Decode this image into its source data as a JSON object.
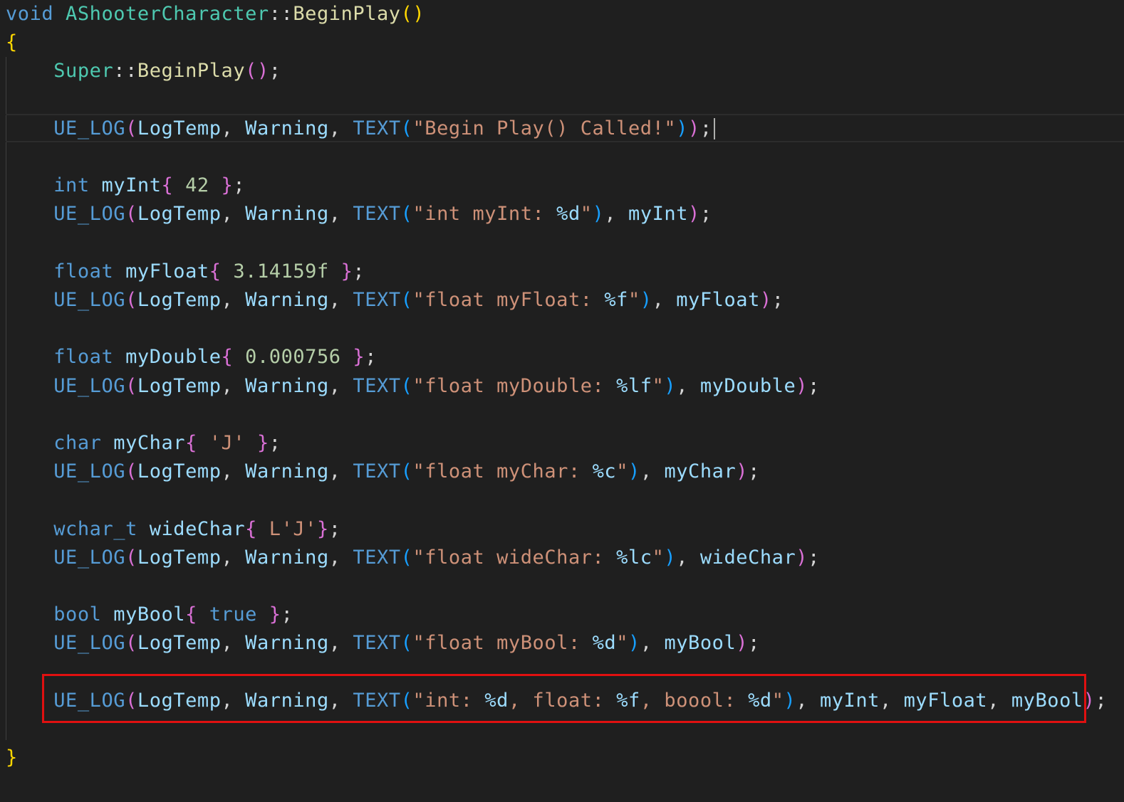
{
  "editor": {
    "cursor_line": 4,
    "highlighted_line": 27,
    "lines": [
      [
        {
          "t": "void ",
          "c": "kw"
        },
        {
          "t": "AShooterCharacter",
          "c": "type"
        },
        {
          "t": "::",
          "c": "plain"
        },
        {
          "t": "BeginPlay",
          "c": "fn"
        },
        {
          "t": "()",
          "c": "b1"
        }
      ],
      [
        {
          "t": "{",
          "c": "b1"
        }
      ],
      [
        {
          "t": "    ",
          "c": "plain"
        },
        {
          "t": "Super",
          "c": "type"
        },
        {
          "t": "::",
          "c": "plain"
        },
        {
          "t": "BeginPlay",
          "c": "fn"
        },
        {
          "t": "()",
          "c": "b2"
        },
        {
          "t": ";",
          "c": "plain"
        }
      ],
      [],
      [
        {
          "t": "    ",
          "c": "plain"
        },
        {
          "t": "UE_LOG",
          "c": "macro"
        },
        {
          "t": "(",
          "c": "b2"
        },
        {
          "t": "LogTemp",
          "c": "var"
        },
        {
          "t": ", ",
          "c": "plain"
        },
        {
          "t": "Warning",
          "c": "var"
        },
        {
          "t": ", ",
          "c": "plain"
        },
        {
          "t": "TEXT",
          "c": "macro"
        },
        {
          "t": "(",
          "c": "b3"
        },
        {
          "t": "\"Begin Play() Called!\"",
          "c": "str"
        },
        {
          "t": ")",
          "c": "b3"
        },
        {
          "t": ")",
          "c": "b2"
        },
        {
          "t": ";",
          "c": "plain"
        }
      ],
      [],
      [
        {
          "t": "    ",
          "c": "plain"
        },
        {
          "t": "int ",
          "c": "kw"
        },
        {
          "t": "myInt",
          "c": "var"
        },
        {
          "t": "{",
          "c": "b2"
        },
        {
          "t": " 42 ",
          "c": "num"
        },
        {
          "t": "}",
          "c": "b2"
        },
        {
          "t": ";",
          "c": "plain"
        }
      ],
      [
        {
          "t": "    ",
          "c": "plain"
        },
        {
          "t": "UE_LOG",
          "c": "macro"
        },
        {
          "t": "(",
          "c": "b2"
        },
        {
          "t": "LogTemp",
          "c": "var"
        },
        {
          "t": ", ",
          "c": "plain"
        },
        {
          "t": "Warning",
          "c": "var"
        },
        {
          "t": ", ",
          "c": "plain"
        },
        {
          "t": "TEXT",
          "c": "macro"
        },
        {
          "t": "(",
          "c": "b3"
        },
        {
          "t": "\"int myInt: ",
          "c": "str"
        },
        {
          "t": "%d",
          "c": "var"
        },
        {
          "t": "\"",
          "c": "str"
        },
        {
          "t": ")",
          "c": "b3"
        },
        {
          "t": ", ",
          "c": "plain"
        },
        {
          "t": "myInt",
          "c": "var"
        },
        {
          "t": ")",
          "c": "b2"
        },
        {
          "t": ";",
          "c": "plain"
        }
      ],
      [],
      [
        {
          "t": "    ",
          "c": "plain"
        },
        {
          "t": "float ",
          "c": "kw"
        },
        {
          "t": "myFloat",
          "c": "var"
        },
        {
          "t": "{",
          "c": "b2"
        },
        {
          "t": " 3.14159f ",
          "c": "num"
        },
        {
          "t": "}",
          "c": "b2"
        },
        {
          "t": ";",
          "c": "plain"
        }
      ],
      [
        {
          "t": "    ",
          "c": "plain"
        },
        {
          "t": "UE_LOG",
          "c": "macro"
        },
        {
          "t": "(",
          "c": "b2"
        },
        {
          "t": "LogTemp",
          "c": "var"
        },
        {
          "t": ", ",
          "c": "plain"
        },
        {
          "t": "Warning",
          "c": "var"
        },
        {
          "t": ", ",
          "c": "plain"
        },
        {
          "t": "TEXT",
          "c": "macro"
        },
        {
          "t": "(",
          "c": "b3"
        },
        {
          "t": "\"float myFloat: ",
          "c": "str"
        },
        {
          "t": "%f",
          "c": "var"
        },
        {
          "t": "\"",
          "c": "str"
        },
        {
          "t": ")",
          "c": "b3"
        },
        {
          "t": ", ",
          "c": "plain"
        },
        {
          "t": "myFloat",
          "c": "var"
        },
        {
          "t": ")",
          "c": "b2"
        },
        {
          "t": ";",
          "c": "plain"
        }
      ],
      [],
      [
        {
          "t": "    ",
          "c": "plain"
        },
        {
          "t": "float ",
          "c": "kw"
        },
        {
          "t": "myDouble",
          "c": "var"
        },
        {
          "t": "{",
          "c": "b2"
        },
        {
          "t": " 0.000756 ",
          "c": "num"
        },
        {
          "t": "}",
          "c": "b2"
        },
        {
          "t": ";",
          "c": "plain"
        }
      ],
      [
        {
          "t": "    ",
          "c": "plain"
        },
        {
          "t": "UE_LOG",
          "c": "macro"
        },
        {
          "t": "(",
          "c": "b2"
        },
        {
          "t": "LogTemp",
          "c": "var"
        },
        {
          "t": ", ",
          "c": "plain"
        },
        {
          "t": "Warning",
          "c": "var"
        },
        {
          "t": ", ",
          "c": "plain"
        },
        {
          "t": "TEXT",
          "c": "macro"
        },
        {
          "t": "(",
          "c": "b3"
        },
        {
          "t": "\"float myDouble: ",
          "c": "str"
        },
        {
          "t": "%lf",
          "c": "var"
        },
        {
          "t": "\"",
          "c": "str"
        },
        {
          "t": ")",
          "c": "b3"
        },
        {
          "t": ", ",
          "c": "plain"
        },
        {
          "t": "myDouble",
          "c": "var"
        },
        {
          "t": ")",
          "c": "b2"
        },
        {
          "t": ";",
          "c": "plain"
        }
      ],
      [],
      [
        {
          "t": "    ",
          "c": "plain"
        },
        {
          "t": "char ",
          "c": "kw"
        },
        {
          "t": "myChar",
          "c": "var"
        },
        {
          "t": "{",
          "c": "b2"
        },
        {
          "t": " 'J' ",
          "c": "str"
        },
        {
          "t": "}",
          "c": "b2"
        },
        {
          "t": ";",
          "c": "plain"
        }
      ],
      [
        {
          "t": "    ",
          "c": "plain"
        },
        {
          "t": "UE_LOG",
          "c": "macro"
        },
        {
          "t": "(",
          "c": "b2"
        },
        {
          "t": "LogTemp",
          "c": "var"
        },
        {
          "t": ", ",
          "c": "plain"
        },
        {
          "t": "Warning",
          "c": "var"
        },
        {
          "t": ", ",
          "c": "plain"
        },
        {
          "t": "TEXT",
          "c": "macro"
        },
        {
          "t": "(",
          "c": "b3"
        },
        {
          "t": "\"float myChar: ",
          "c": "str"
        },
        {
          "t": "%c",
          "c": "var"
        },
        {
          "t": "\"",
          "c": "str"
        },
        {
          "t": ")",
          "c": "b3"
        },
        {
          "t": ", ",
          "c": "plain"
        },
        {
          "t": "myChar",
          "c": "var"
        },
        {
          "t": ")",
          "c": "b2"
        },
        {
          "t": ";",
          "c": "plain"
        }
      ],
      [],
      [
        {
          "t": "    ",
          "c": "plain"
        },
        {
          "t": "wchar_t ",
          "c": "kw"
        },
        {
          "t": "wideChar",
          "c": "var"
        },
        {
          "t": "{",
          "c": "b2"
        },
        {
          "t": " L'J'",
          "c": "str"
        },
        {
          "t": "}",
          "c": "b2"
        },
        {
          "t": ";",
          "c": "plain"
        }
      ],
      [
        {
          "t": "    ",
          "c": "plain"
        },
        {
          "t": "UE_LOG",
          "c": "macro"
        },
        {
          "t": "(",
          "c": "b2"
        },
        {
          "t": "LogTemp",
          "c": "var"
        },
        {
          "t": ", ",
          "c": "plain"
        },
        {
          "t": "Warning",
          "c": "var"
        },
        {
          "t": ", ",
          "c": "plain"
        },
        {
          "t": "TEXT",
          "c": "macro"
        },
        {
          "t": "(",
          "c": "b3"
        },
        {
          "t": "\"float wideChar: ",
          "c": "str"
        },
        {
          "t": "%lc",
          "c": "var"
        },
        {
          "t": "\"",
          "c": "str"
        },
        {
          "t": ")",
          "c": "b3"
        },
        {
          "t": ", ",
          "c": "plain"
        },
        {
          "t": "wideChar",
          "c": "var"
        },
        {
          "t": ")",
          "c": "b2"
        },
        {
          "t": ";",
          "c": "plain"
        }
      ],
      [],
      [
        {
          "t": "    ",
          "c": "plain"
        },
        {
          "t": "bool ",
          "c": "kw"
        },
        {
          "t": "myBool",
          "c": "var"
        },
        {
          "t": "{",
          "c": "b2"
        },
        {
          "t": " ",
          "c": "plain"
        },
        {
          "t": "true",
          "c": "kw"
        },
        {
          "t": " ",
          "c": "plain"
        },
        {
          "t": "}",
          "c": "b2"
        },
        {
          "t": ";",
          "c": "plain"
        }
      ],
      [
        {
          "t": "    ",
          "c": "plain"
        },
        {
          "t": "UE_LOG",
          "c": "macro"
        },
        {
          "t": "(",
          "c": "b2"
        },
        {
          "t": "LogTemp",
          "c": "var"
        },
        {
          "t": ", ",
          "c": "plain"
        },
        {
          "t": "Warning",
          "c": "var"
        },
        {
          "t": ", ",
          "c": "plain"
        },
        {
          "t": "TEXT",
          "c": "macro"
        },
        {
          "t": "(",
          "c": "b3"
        },
        {
          "t": "\"float myBool: ",
          "c": "str"
        },
        {
          "t": "%d",
          "c": "var"
        },
        {
          "t": "\"",
          "c": "str"
        },
        {
          "t": ")",
          "c": "b3"
        },
        {
          "t": ", ",
          "c": "plain"
        },
        {
          "t": "myBool",
          "c": "var"
        },
        {
          "t": ")",
          "c": "b2"
        },
        {
          "t": ";",
          "c": "plain"
        }
      ],
      [],
      [
        {
          "t": "    ",
          "c": "plain"
        },
        {
          "t": "UE_LOG",
          "c": "macro"
        },
        {
          "t": "(",
          "c": "b2"
        },
        {
          "t": "LogTemp",
          "c": "var"
        },
        {
          "t": ", ",
          "c": "plain"
        },
        {
          "t": "Warning",
          "c": "var"
        },
        {
          "t": ", ",
          "c": "plain"
        },
        {
          "t": "TEXT",
          "c": "macro"
        },
        {
          "t": "(",
          "c": "b3"
        },
        {
          "t": "\"int: ",
          "c": "str"
        },
        {
          "t": "%d",
          "c": "var"
        },
        {
          "t": ", float: ",
          "c": "str"
        },
        {
          "t": "%f",
          "c": "var"
        },
        {
          "t": ", boool: ",
          "c": "str"
        },
        {
          "t": "%d",
          "c": "var"
        },
        {
          "t": "\"",
          "c": "str"
        },
        {
          "t": ")",
          "c": "b3"
        },
        {
          "t": ", ",
          "c": "plain"
        },
        {
          "t": "myInt",
          "c": "var"
        },
        {
          "t": ", ",
          "c": "plain"
        },
        {
          "t": "myFloat",
          "c": "var"
        },
        {
          "t": ", ",
          "c": "plain"
        },
        {
          "t": "myBool",
          "c": "var"
        },
        {
          "t": ")",
          "c": "b2"
        },
        {
          "t": ";",
          "c": "plain"
        }
      ],
      [],
      [
        {
          "t": "}",
          "c": "b1"
        }
      ]
    ]
  },
  "colors": {
    "background": "#1f1f1f",
    "keyword": "#569cd6",
    "type": "#4ec9b0",
    "function": "#dcdcaa",
    "variable": "#9cdcfe",
    "string": "#ce9178",
    "number": "#b5cea8",
    "bracket_level1": "#ffd700",
    "bracket_level2": "#da70d6",
    "bracket_level3": "#179fff",
    "highlight_box": "#e01010"
  }
}
